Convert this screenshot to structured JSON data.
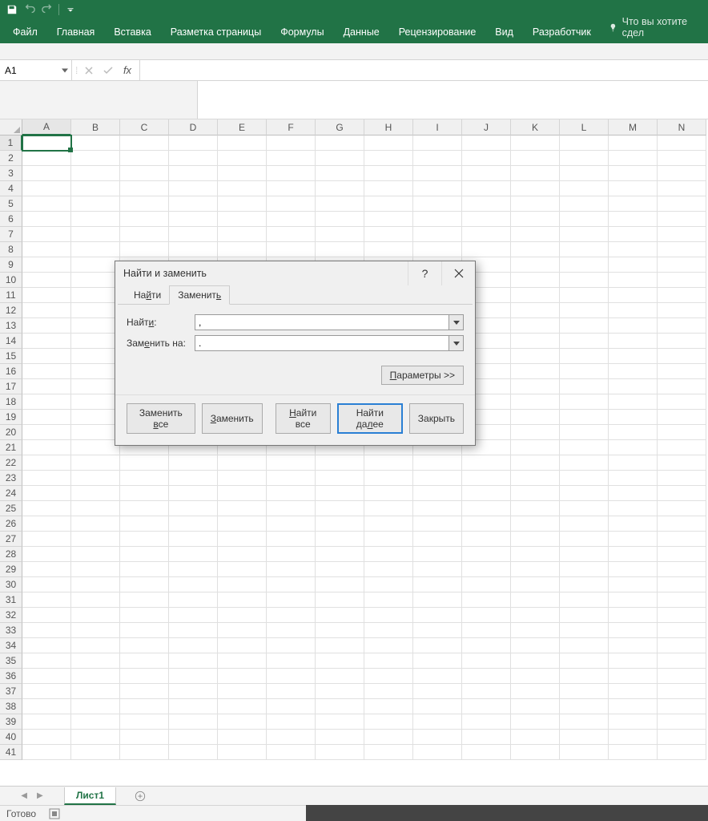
{
  "qat": {
    "save": "save",
    "undo": "undo",
    "redo": "redo"
  },
  "ribbon": {
    "tabs": [
      "Файл",
      "Главная",
      "Вставка",
      "Разметка страницы",
      "Формулы",
      "Данные",
      "Рецензирование",
      "Вид",
      "Разработчик"
    ],
    "tellme": "Что вы хотите сдел"
  },
  "namebox": {
    "value": "A1"
  },
  "formula": {
    "value": ""
  },
  "columns": [
    "A",
    "B",
    "C",
    "D",
    "E",
    "F",
    "G",
    "H",
    "I",
    "J",
    "K",
    "L",
    "M",
    "N"
  ],
  "rows": [
    "1",
    "2",
    "3",
    "4",
    "5",
    "6",
    "7",
    "8",
    "9",
    "10",
    "11",
    "12",
    "13",
    "14",
    "15",
    "16",
    "17",
    "18",
    "19",
    "20",
    "21",
    "22",
    "23",
    "24",
    "25",
    "26",
    "27",
    "28",
    "29",
    "30",
    "31",
    "32",
    "33",
    "34",
    "35",
    "36",
    "37",
    "38",
    "39",
    "40",
    "41"
  ],
  "active_cell": "A1",
  "sheet": {
    "name": "Лист1"
  },
  "status": {
    "ready": "Готово"
  },
  "dialog": {
    "title": "Найти и заменить",
    "help": "?",
    "tabs": {
      "find": "Найти",
      "find_u": "и",
      "replace": "Заменить",
      "replace_u": "ь"
    },
    "find_label": "Найти:",
    "find_u": "и",
    "replace_label": "Заменить на:",
    "replace_label_u": "е",
    "find_value": ",",
    "replace_value": ".",
    "params": "Параметры >>",
    "params_u": "П",
    "btn_replace_all": "Заменить все",
    "btn_replace_all_u": "в",
    "btn_replace": "Заменить",
    "btn_replace_u": "З",
    "btn_find_all": "Найти все",
    "btn_find_all_u": "Н",
    "btn_find_next": "Найти далее",
    "btn_find_next_u": "л",
    "btn_close": "Закрыть"
  }
}
